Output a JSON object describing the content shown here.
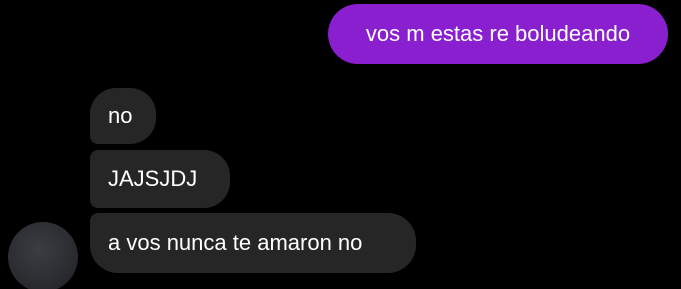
{
  "conversation": {
    "sent": [
      {
        "text": "vos m estas re boludeando"
      }
    ],
    "received": [
      {
        "text": "no"
      },
      {
        "text": "JAJSJDJ"
      },
      {
        "text": "a vos nunca te amaron no"
      }
    ]
  },
  "colors": {
    "background": "#000000",
    "sent_bubble": "#8a1fcf",
    "received_bubble": "#262626",
    "text": "#ffffff"
  }
}
